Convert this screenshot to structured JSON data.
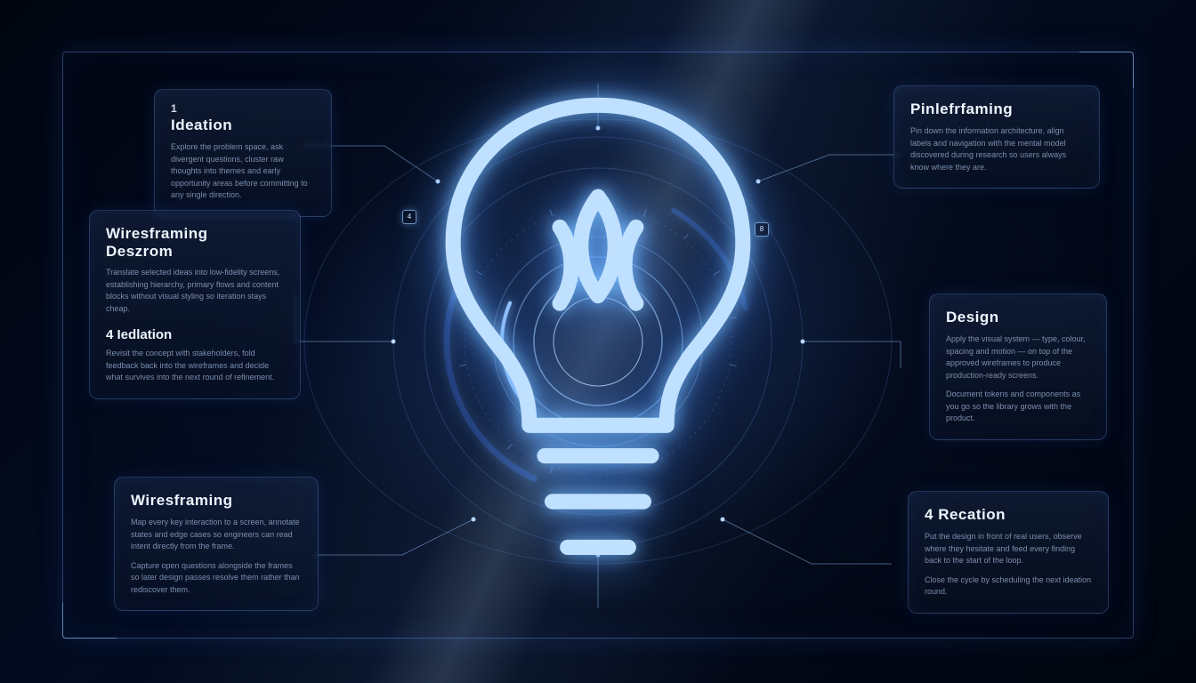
{
  "cards": {
    "ideation": {
      "num": "1",
      "title": "Ideation",
      "body": "Explore the problem space, ask divergent questions, cluster raw thoughts into themes and early opportunity areas before committing to any single direction."
    },
    "wfdesign": {
      "title_a": "Wiresframing",
      "title_b": "Deszrom",
      "body": "Translate selected ideas into low-fidelity screens, establishing hierarchy, primary flows and content blocks without visual styling so iteration stays cheap.",
      "sub_num": "4",
      "sub_title": "Iedlation",
      "sub_body": "Revisit the concept with stakeholders, fold feedback back into the wireframes and decide what survives into the next round of refinement."
    },
    "wireframe": {
      "title": "Wiresframing",
      "body1": "Map every key interaction to a screen, annotate states and edge cases so engineers can read intent directly from the frame.",
      "body2": "Capture open questions alongside the frames so later design passes resolve them rather than rediscover them."
    },
    "pinleft": {
      "title": "Pinlefrfaming",
      "body": "Pin down the information architecture, align labels and navigation with the mental model discovered during research so users always know where they are."
    },
    "design": {
      "title": "Design",
      "body1": "Apply the visual system — type, colour, spacing and motion — on top of the approved wireframes to produce production-ready screens.",
      "body2": "Document tokens and components as you go so the library grows with the product."
    },
    "recation": {
      "num": "4",
      "title": "Recation",
      "body1": "Put the design in front of real users, observe where they hesitate and feed every finding back to the start of the loop.",
      "body2": "Close the cycle by scheduling the next ideation round."
    }
  },
  "markers": {
    "left": "4",
    "right": "8"
  }
}
